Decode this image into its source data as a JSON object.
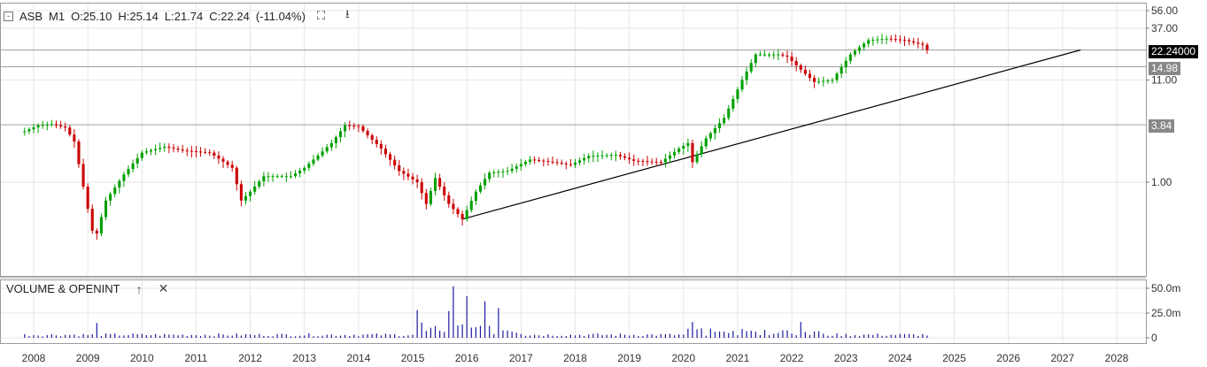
{
  "legend": {
    "symbol": "ASB",
    "interval": "M1",
    "open": "O:25.10",
    "high": "H:25.14",
    "low": "L:21.74",
    "close": "C:22.24",
    "change": "(-11.04%)"
  },
  "volume_panel": {
    "title": "VOLUME & OPENINT"
  },
  "price_tags": [
    {
      "label": "22.24000",
      "bg": "#000000",
      "fg": "#ffffff",
      "price": 22.24
    },
    {
      "label": "14.98",
      "bg": "#888888",
      "fg": "#ffffff",
      "price": 14.98
    },
    {
      "label": "3.84",
      "bg": "#888888",
      "fg": "#ffffff",
      "price": 3.84
    }
  ],
  "colors": {
    "up": "#00a000",
    "down": "#cc0000",
    "volume": "#1a1aa0",
    "grid": "#e6e6e6",
    "level_line": "#a0a0a0",
    "trend_line": "#000000"
  },
  "chart_data": [
    {
      "type": "candlestick",
      "title": "ASB M1",
      "y_scale": "log",
      "y_ticks": [
        "56.00",
        "37.00",
        "11.00",
        "1.00"
      ],
      "ylim": [
        0.12,
        68
      ],
      "x_ticks": [
        "2008",
        "2009",
        "2010",
        "2011",
        "2012",
        "2013",
        "2014",
        "2015",
        "2016",
        "2017",
        "2018",
        "2019",
        "2020",
        "2021",
        "2022",
        "2023",
        "2024",
        "2025",
        "2026",
        "2027",
        "2028"
      ],
      "anchors": [
        [
          "2007-11",
          3.3
        ],
        [
          "2008-02",
          3.8
        ],
        [
          "2008-05",
          3.9
        ],
        [
          "2008-08",
          3.6
        ],
        [
          "2008-10",
          2.6
        ],
        [
          "2008-12",
          0.9
        ],
        [
          "2009-02",
          0.32
        ],
        [
          "2009-03",
          0.3
        ],
        [
          "2009-05",
          0.65
        ],
        [
          "2009-09",
          1.2
        ],
        [
          "2010-01",
          2.0
        ],
        [
          "2010-06",
          2.3
        ],
        [
          "2010-10",
          2.1
        ],
        [
          "2011-04",
          2.0
        ],
        [
          "2011-09",
          1.4
        ],
        [
          "2011-11",
          0.65
        ],
        [
          "2012-01",
          0.8
        ],
        [
          "2012-04",
          1.15
        ],
        [
          "2012-10",
          1.15
        ],
        [
          "2013-01",
          1.4
        ],
        [
          "2013-07",
          2.5
        ],
        [
          "2013-10",
          3.8
        ],
        [
          "2014-01",
          3.7
        ],
        [
          "2014-06",
          2.2
        ],
        [
          "2014-10",
          1.3
        ],
        [
          "2015-02",
          1.0
        ],
        [
          "2015-04",
          0.6
        ],
        [
          "2015-06",
          1.1
        ],
        [
          "2015-09",
          0.6
        ],
        [
          "2015-12",
          0.42
        ],
        [
          "2016-03",
          0.8
        ],
        [
          "2016-06",
          1.25
        ],
        [
          "2016-10",
          1.3
        ],
        [
          "2017-03",
          1.7
        ],
        [
          "2017-08",
          1.6
        ],
        [
          "2017-12",
          1.5
        ],
        [
          "2018-04",
          1.85
        ],
        [
          "2018-10",
          1.9
        ],
        [
          "2019-02",
          1.65
        ],
        [
          "2019-08",
          1.6
        ],
        [
          "2019-12",
          2.2
        ],
        [
          "2020-02",
          2.5
        ],
        [
          "2020-03",
          1.6
        ],
        [
          "2020-06",
          2.8
        ],
        [
          "2020-10",
          4.5
        ],
        [
          "2021-02",
          11.0
        ],
        [
          "2021-05",
          20.0
        ],
        [
          "2021-10",
          20.0
        ],
        [
          "2021-12",
          19.0
        ],
        [
          "2022-03",
          14.0
        ],
        [
          "2022-06",
          10.5
        ],
        [
          "2022-10",
          11.0
        ],
        [
          "2023-02",
          20.0
        ],
        [
          "2023-06",
          28.0
        ],
        [
          "2023-10",
          29.0
        ],
        [
          "2024-02",
          28.0
        ],
        [
          "2024-06",
          25.1
        ],
        [
          "2024-07",
          22.24
        ]
      ],
      "last_candle": {
        "open": 25.1,
        "high": 25.14,
        "low": 21.74,
        "close": 22.24,
        "change_pct": -11.04
      },
      "horizontal_levels": [
        22.24,
        14.98,
        3.84
      ],
      "trend_line": {
        "from": [
          "2015-12",
          0.42
        ],
        "to": [
          "2027-05",
          22.24
        ]
      }
    },
    {
      "type": "bar",
      "title": "VOLUME & OPENINT",
      "y_ticks": [
        "50.0m",
        "25.0m",
        "0"
      ],
      "ylim": [
        0,
        60
      ],
      "unit": "m",
      "peaks": [
        [
          "2009-03",
          15
        ],
        [
          "2015-02",
          28
        ],
        [
          "2015-09",
          27
        ],
        [
          "2015-10",
          52
        ],
        [
          "2016-01",
          42
        ],
        [
          "2016-05",
          37
        ],
        [
          "2016-08",
          30
        ],
        [
          "2020-03",
          16
        ],
        [
          "2022-03",
          16
        ]
      ],
      "base_level": 3
    }
  ]
}
